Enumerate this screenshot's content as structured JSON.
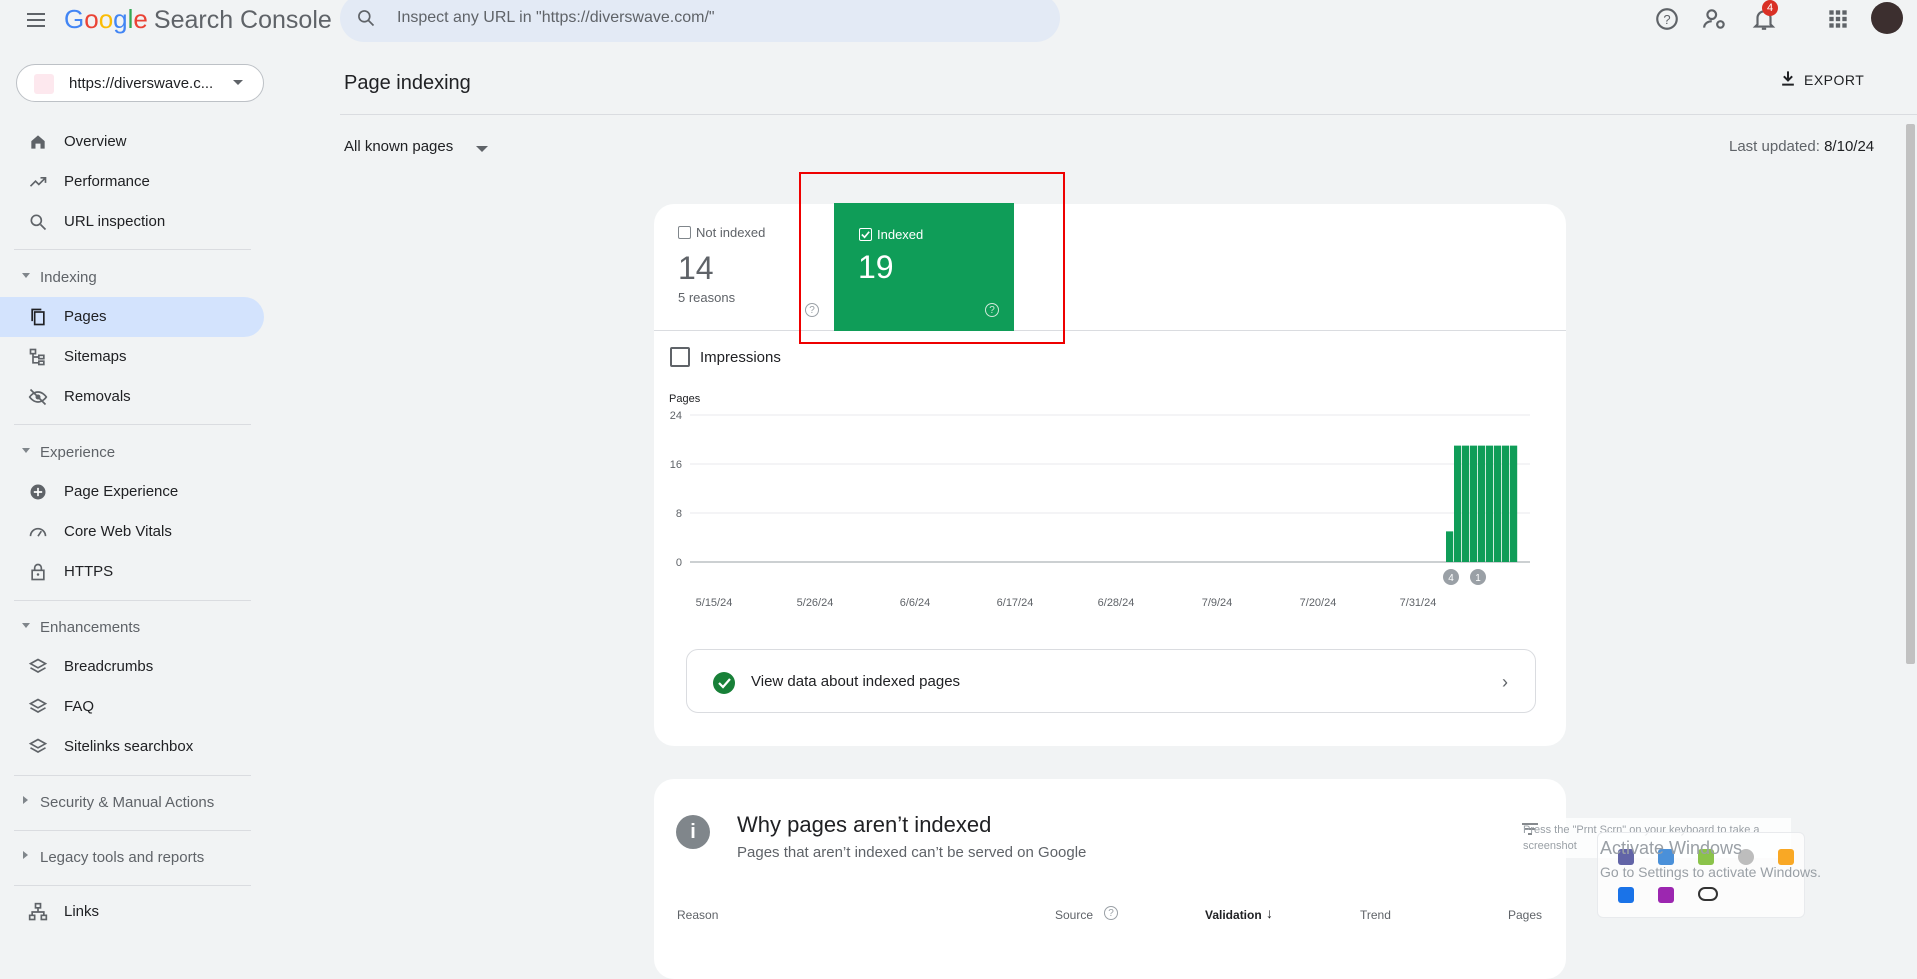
{
  "header": {
    "logo_google_letters": [
      "G",
      "o",
      "o",
      "g",
      "l",
      "e"
    ],
    "logo_product": "Search Console",
    "search_placeholder": "Inspect any URL in \"https://diverswave.com/\"",
    "notification_count": "4"
  },
  "sidebar": {
    "property": "https://diverswave.c...",
    "top_items": [
      {
        "label": "Overview",
        "icon": "home-icon"
      },
      {
        "label": "Performance",
        "icon": "trending-icon"
      },
      {
        "label": "URL inspection",
        "icon": "search-icon"
      }
    ],
    "sections": [
      {
        "title": "Indexing",
        "items": [
          {
            "label": "Pages",
            "icon": "pages-icon",
            "active": true
          },
          {
            "label": "Sitemaps",
            "icon": "sitemap-icon"
          },
          {
            "label": "Removals",
            "icon": "eye-off-icon"
          }
        ]
      },
      {
        "title": "Experience",
        "items": [
          {
            "label": "Page Experience",
            "icon": "plus-circle-icon"
          },
          {
            "label": "Core Web Vitals",
            "icon": "gauge-icon"
          },
          {
            "label": "HTTPS",
            "icon": "lock-icon"
          }
        ]
      },
      {
        "title": "Enhancements",
        "items": [
          {
            "label": "Breadcrumbs",
            "icon": "layers-icon"
          },
          {
            "label": "FAQ",
            "icon": "layers-icon"
          },
          {
            "label": "Sitelinks searchbox",
            "icon": "layers-icon"
          }
        ]
      }
    ],
    "collapsed_sections": [
      "Security & Manual Actions",
      "Legacy tools and reports"
    ],
    "bottom_item": {
      "label": "Links",
      "icon": "links-icon"
    }
  },
  "main": {
    "title": "Page indexing",
    "export_label": "EXPORT",
    "filter": "All known pages",
    "last_updated_label": "Last updated:",
    "last_updated_value": "8/10/24",
    "not_indexed": {
      "label": "Not indexed",
      "count": "14",
      "sub": "5 reasons"
    },
    "indexed": {
      "label": "Indexed",
      "count": "19"
    },
    "impressions_label": "Impressions",
    "view_data_label": "View data about indexed pages",
    "why": {
      "title": "Why pages aren’t indexed",
      "subtitle": "Pages that aren’t indexed can’t be served on Google",
      "columns": [
        "Reason",
        "Source",
        "Validation",
        "Trend",
        "Pages"
      ]
    }
  },
  "overlay": {
    "tip": "Press the \"Prnt Scrn\" on your keyboard to take a screenshot",
    "activate_title": "Activate Windows",
    "activate_sub": "Go to Settings to activate Windows."
  },
  "chart_data": {
    "type": "bar",
    "ylabel": "Pages",
    "ylim": [
      0,
      24
    ],
    "yticks": [
      0,
      8,
      16,
      24
    ],
    "xticks": [
      "5/15/24",
      "5/26/24",
      "6/6/24",
      "6/17/24",
      "6/28/24",
      "7/9/24",
      "7/20/24",
      "7/31/24"
    ],
    "series": [
      {
        "name": "Indexed",
        "color": "#0f9d58",
        "values": [
          5,
          19,
          19,
          19,
          19,
          19,
          19,
          19,
          19
        ]
      }
    ],
    "annotations": [
      "4",
      "1"
    ]
  },
  "colors": {
    "accent": "#0f9d58",
    "active_nav": "#d3e3fd",
    "highlight_border": "#ee0000"
  }
}
